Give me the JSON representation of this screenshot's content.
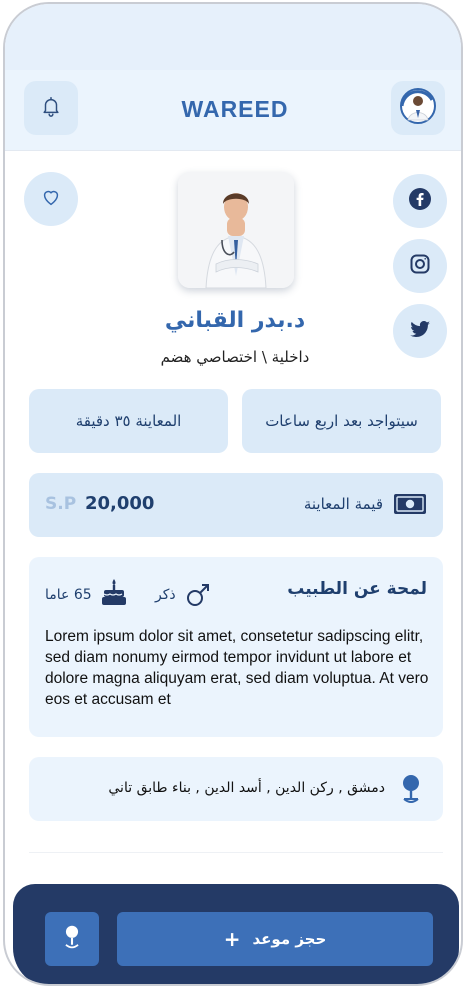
{
  "header": {
    "logo_text": "WAREED",
    "left_icon": "bell-icon",
    "right_icon": "doctor-avatar"
  },
  "doctor": {
    "name": "د.بدر القباني",
    "specialty": "داخلية \\ اختصاصي هضم"
  },
  "social": [
    "facebook-icon",
    "instagram-icon",
    "twitter-icon"
  ],
  "availability": {
    "presence": "سيتواجد بعد اربع ساعات",
    "duration": "المعاينة ٣٥ دقيقة"
  },
  "price": {
    "label": "قيمة المعاينة",
    "value": "20,000",
    "currency": "S.P"
  },
  "about": {
    "title": "لمحة عن الطبيب",
    "gender": "ذكر",
    "age": "65 عاما",
    "text": "Lorem ipsum dolor sit amet, consetetur sadipscing elitr, sed diam nonumy eirmod tempor invidunt ut labore et dolore magna aliquyam erat, sed diam voluptua. At vero eos et accusam et"
  },
  "address": {
    "text": "دمشق , ركن الدين , أسد الدين , بناء طابق تاني"
  },
  "bottom": {
    "book_label": "حجز موعد",
    "book_plus": "+"
  },
  "colors": {
    "primary": "#3467ad",
    "accent_bg": "#dbeaf8",
    "light_bg": "#ebf4fd",
    "bottom_bar": "#243a66",
    "button": "#3d70b8"
  }
}
